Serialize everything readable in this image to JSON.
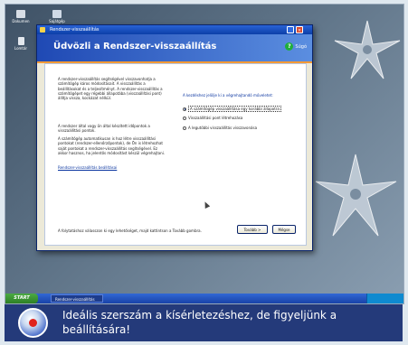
{
  "desktop": {
    "icons": [
      {
        "label": "Dokumen"
      },
      {
        "label": "Sajátgép"
      },
      {
        "label": "Lomtár"
      }
    ]
  },
  "window": {
    "title": "Rendszer-visszaállítás",
    "header_title": "Üdvözli a Rendszer-visszaállítás",
    "help_label": "Súgó",
    "paragraphs": [
      "A rendszer-visszaállítás segítségével visszavonhatja a számítógép káros módosításait. A visszaállítás a beállításokat és a teljesítményt. A rendszer-visszaállítás a számítógépet egy régebbi állapotába (visszaállítási pont) állítja vissza, kockázat nélkül.",
      "A rendszer által vagy ön által készített időpontok a visszaállítási pontok.",
      "A számítógép automatikusan is hoz létre visszaállítási pontokat (rendszer-ellenőrzőpontok), de Ön is létrehozhat saját pontokat a rendszer-visszaállítás segítségével. Ez akkor hasznos, ha jelentős módosítást készül végrehajtani."
    ],
    "settings_link": "Rendszer-visszaállítás beállításai",
    "prompt": "A kezdéshez jelölje ki a végrehajtandó műveletet:",
    "options": [
      {
        "label": "A számítógép visszaállítása egy korábbi állapotra",
        "selected": true
      },
      {
        "label": "Visszaállítási pont létrehozása",
        "selected": false
      },
      {
        "label": "A legutóbbi visszaállítás visszavonása",
        "selected": false
      }
    ],
    "footer_text": "A folytatáshoz válasszon ki egy lehetőséget, majd kattintson a Tovább gombra.",
    "next_button": "Tovább >",
    "cancel_button": "Mégse"
  },
  "taskbar": {
    "start_label": "START",
    "task_label": "Rendszer-visszaállítás"
  },
  "caption": {
    "text": "Ideális szerszám a kísérletezéshez, de figyeljünk a beállítására!"
  },
  "colors": {
    "caption_bg": "#243a7a",
    "title_blue": "#0b3fa8",
    "header_stripe": "#f49a36",
    "start_green": "#2d7f25"
  }
}
